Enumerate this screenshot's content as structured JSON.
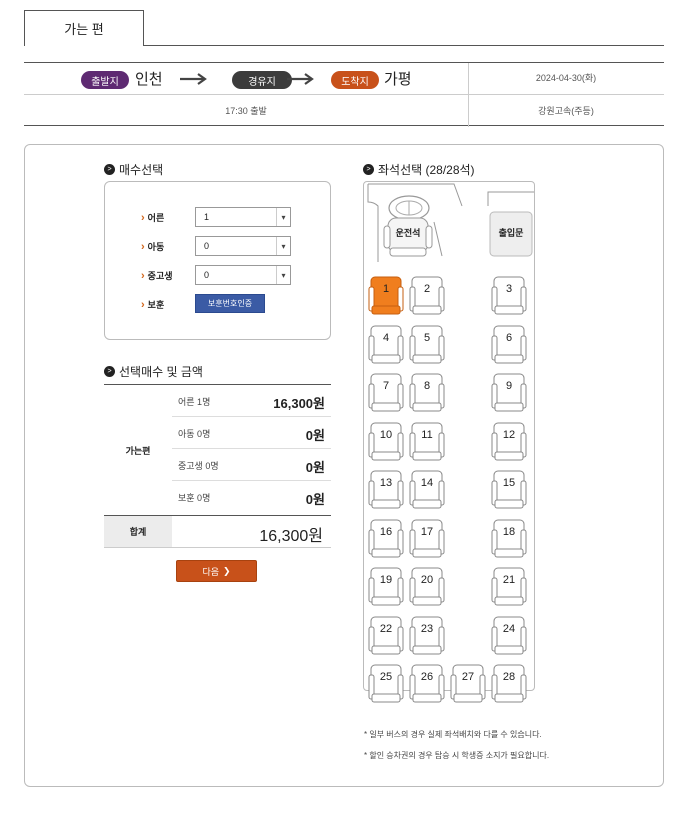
{
  "tab": {
    "label": "가는 편"
  },
  "route": {
    "departure_badge": "출발지",
    "departure": "인천",
    "via_badge": "경유지",
    "arrival_badge": "도착지",
    "arrival": "가평",
    "date": "2024-04-30(화)",
    "time": "17:30 출발",
    "company": "강원고속(주등)"
  },
  "count_section": {
    "title": "매수선택",
    "rows": [
      {
        "label": "어른",
        "value": "1"
      },
      {
        "label": "아동",
        "value": "0"
      },
      {
        "label": "중고생",
        "value": "0"
      }
    ],
    "veteran": {
      "label": "보훈",
      "button": "보훈번호인증"
    }
  },
  "price_section": {
    "title": "선택매수 및 금액",
    "direction": "가는편",
    "rows": [
      {
        "label": "어른 1명",
        "value": "16,300원"
      },
      {
        "label": "아동 0명",
        "value": "0원"
      },
      {
        "label": "중고생 0명",
        "value": "0원"
      },
      {
        "label": "보훈 0명",
        "value": "0원"
      }
    ],
    "total_label": "합계",
    "total_value": "16,300원",
    "next_button": "다음"
  },
  "seat_section": {
    "title": "좌석선택 (28/28석)",
    "driver_label": "운전석",
    "door_label": "출입문",
    "selected_seat": "1",
    "seats": [
      "1",
      "2",
      "3",
      "4",
      "5",
      "6",
      "7",
      "8",
      "9",
      "10",
      "11",
      "12",
      "13",
      "14",
      "15",
      "16",
      "17",
      "18",
      "19",
      "20",
      "21",
      "22",
      "23",
      "24",
      "25",
      "26",
      "27",
      "28"
    ],
    "notes": [
      "* 일부 버스의 경우 실제 좌석배치와 다를 수 있습니다.",
      "* 할인 승차권의 경우 탑승 시 학생증 소지가 필요합니다."
    ]
  },
  "colors": {
    "departure": "#5e2a72",
    "via": "#3c3c3c",
    "arrival": "#c8511a",
    "selected_seat": "#f07e1e",
    "next_button": "#c8511a",
    "verify_button": "#3b5ba5"
  }
}
